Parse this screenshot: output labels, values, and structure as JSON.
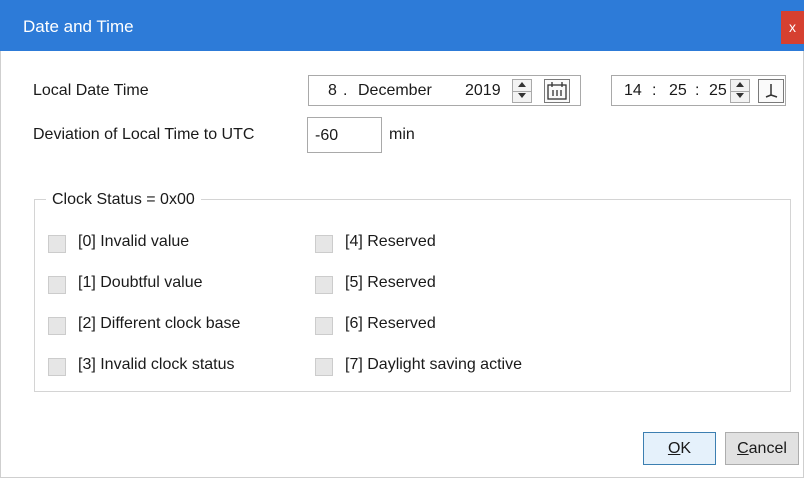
{
  "window": {
    "title": "Date and Time",
    "close_label": "x"
  },
  "local_date_time": {
    "label": "Local Date Time",
    "day": "8",
    "sep1": ".",
    "month": "December",
    "year": "2019",
    "hour": "14",
    "minute": "25",
    "second": "25",
    "time_sep": ":"
  },
  "deviation": {
    "label": "Deviation of Local Time to UTC",
    "value": "-60",
    "unit": "min"
  },
  "clock_status": {
    "title": "Clock Status = 0x00",
    "bits": [
      {
        "label": "[0] Invalid value",
        "checked": false
      },
      {
        "label": "[1] Doubtful value",
        "checked": false
      },
      {
        "label": "[2] Different clock base",
        "checked": false
      },
      {
        "label": "[3] Invalid clock status",
        "checked": false
      },
      {
        "label": "[4] Reserved",
        "checked": false
      },
      {
        "label": "[5] Reserved",
        "checked": false
      },
      {
        "label": "[6] Reserved",
        "checked": false
      },
      {
        "label": "[7] Daylight saving active",
        "checked": false
      }
    ]
  },
  "buttons": {
    "ok_mnemonic": "O",
    "ok_rest": "K",
    "cancel_mnemonic": "C",
    "cancel_rest": "ancel"
  },
  "colors": {
    "titlebar": "#2d7bd8",
    "close": "#d64030"
  }
}
